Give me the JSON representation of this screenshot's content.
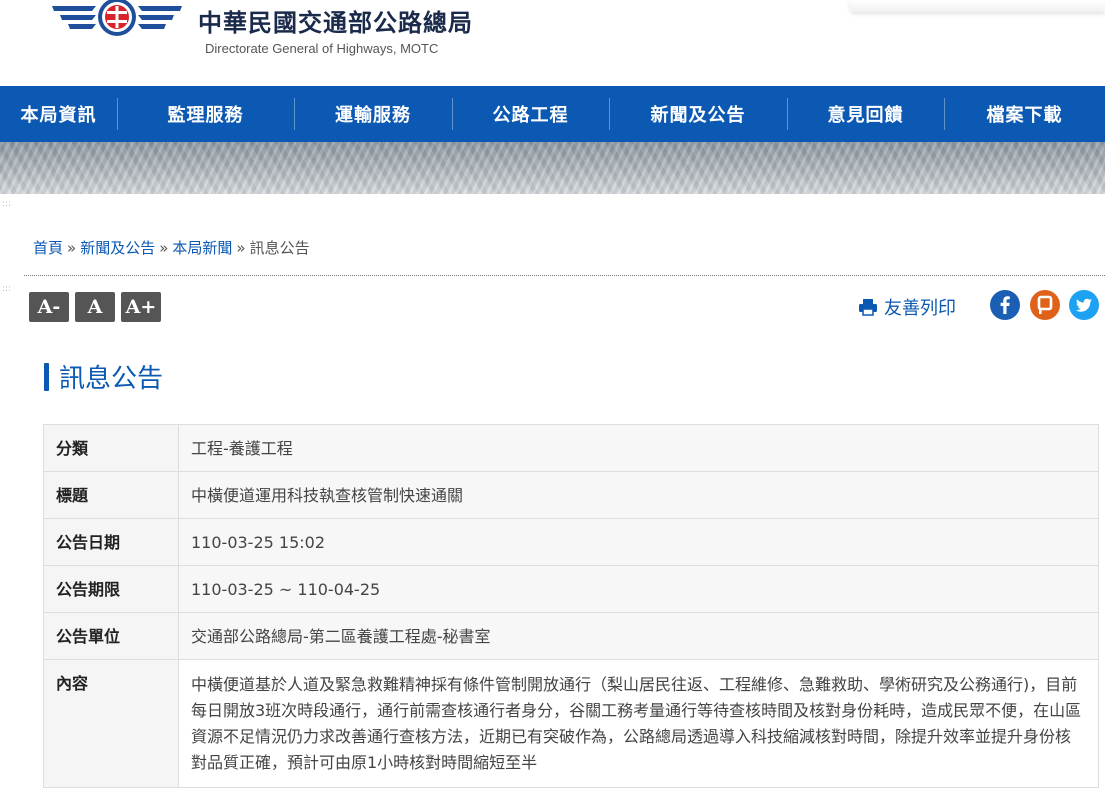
{
  "header": {
    "title_zh": "中華民國交通部公路總局",
    "title_en": "Directorate General of Highways, MOTC"
  },
  "nav": [
    {
      "label": "本局資訊"
    },
    {
      "label": "監理服務"
    },
    {
      "label": "運輸服務"
    },
    {
      "label": "公路工程"
    },
    {
      "label": "新聞及公告"
    },
    {
      "label": "意見回饋"
    },
    {
      "label": "檔案下載"
    }
  ],
  "decor_dots": ":::",
  "breadcrumb": {
    "home": "首頁",
    "sep": "»",
    "level1": "新聞及公告",
    "level2": "本局新聞",
    "current": "訊息公告"
  },
  "font_size_buttons": {
    "smaller": "A-",
    "normal": "A",
    "larger": "A+"
  },
  "print_label": "友善列印",
  "social_icons": [
    "facebook-icon",
    "plurk-icon",
    "twitter-icon"
  ],
  "page_title": "訊息公告",
  "info": {
    "category_label": "分類",
    "category_value": "工程-養護工程",
    "title_label": "標題",
    "title_value": "中橫便道運用科技執查核管制快速通關",
    "date_label": "公告日期",
    "date_value": "110-03-25 15:02",
    "period_label": "公告期限",
    "period_value": "110-03-25 ~ 110-04-25",
    "unit_label": "公告單位",
    "unit_value": "交通部公路總局-第二區養護工程處-秘書室",
    "content_label": "內容",
    "content_value": "中橫便道基於人道及緊急救難精神採有條件管制開放通行（梨山居民往返、工程維修、急難救助、學術研究及公務通行)，目前每日開放3班次時段通行，通行前需查核通行者身分，谷關工務考量通行等待查核時間及核對身份耗時，造成民眾不便，在山區資源不足情況仍力求改善通行查核方法，近期已有突破作為，公路總局透過導入科技縮減核對時間，除提升效率並提升身份核對品質正確，預計可由原1小時核對時間縮短至半"
  },
  "colors": {
    "nav_bg": "#0c59b3",
    "link": "#0c59b3",
    "facebook": "#1a5fb4",
    "plurk": "#e0621a",
    "twitter": "#1da1f2"
  }
}
